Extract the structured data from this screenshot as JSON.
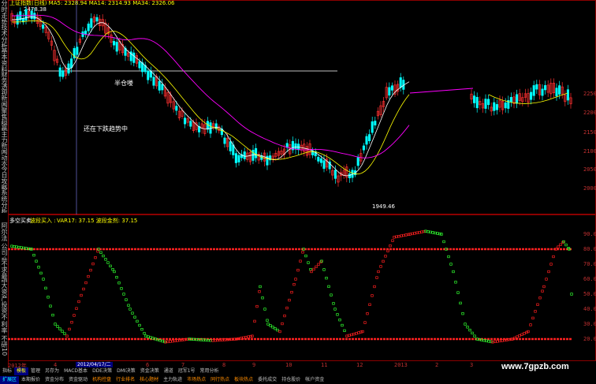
{
  "sidebar": {
    "items": [
      "分时走势",
      "技术分析",
      "基本资料",
      "财务透视",
      "新闻聚焦",
      "超赢主力",
      "新闻动态",
      "今日攻略",
      "系统分析"
    ]
  },
  "top_chart": {
    "header": "上证指数(日线)  MA5: 2328.94  MA14: 2314.93  MA34: 2326.06",
    "high_label": "2478.38",
    "low_label": "1949.46",
    "ann1": "半仓喽",
    "ann2": "还在下跌趋势中",
    "y_ticks": [
      "2250",
      "2200",
      "2150",
      "2100",
      "2050",
      "2000"
    ]
  },
  "bottom_chart": {
    "indicator_name": "多空买卖",
    "header_yellow": "波段买入 :",
    "header_rest": "VAR17: 37.15  波段金剂: 37.15",
    "y_ticks": [
      "90.00",
      "80.00",
      "70.00",
      "60.00",
      "50.00",
      "40.00",
      "30.00",
      "20.00"
    ],
    "left_labels": [
      "阿尔法",
      "公司·我",
      "不求最吧",
      "大资产",
      "投资不",
      "利率",
      "不研10"
    ]
  },
  "x_axis": {
    "ticks": [
      "2012年",
      "4",
      "5",
      "6",
      "7",
      "8",
      "9",
      "10",
      "11",
      "12",
      "2013",
      "2",
      "3"
    ],
    "cursor_date": "2012/04/17/二"
  },
  "tabs": [
    "指标",
    "模板",
    "管理",
    "另存为",
    "MACD基本",
    "DDE决策",
    "DMI决策",
    "资金决策",
    "通道",
    "冠军1号",
    "常用分析"
  ],
  "bottom_bar": [
    "扩展区",
    "本期报价",
    "资金分布",
    "资金驱动",
    "机构控盘",
    "行业排名",
    "核心题材",
    "主力轨迹",
    "市场热点",
    "同行热点",
    "板块热点",
    "委托成交",
    "持仓股价",
    "帐户资金"
  ],
  "watermark": "www.7gpzb.com",
  "colors": {
    "up": "#ff3030",
    "down": "#00ffff",
    "ma5": "#ffffff",
    "ma14": "#ffff00",
    "ma34": "#ff00ff",
    "kdj_up": "#ff2020",
    "kdj_down": "#30ff30",
    "grid": "#8b0000"
  }
}
